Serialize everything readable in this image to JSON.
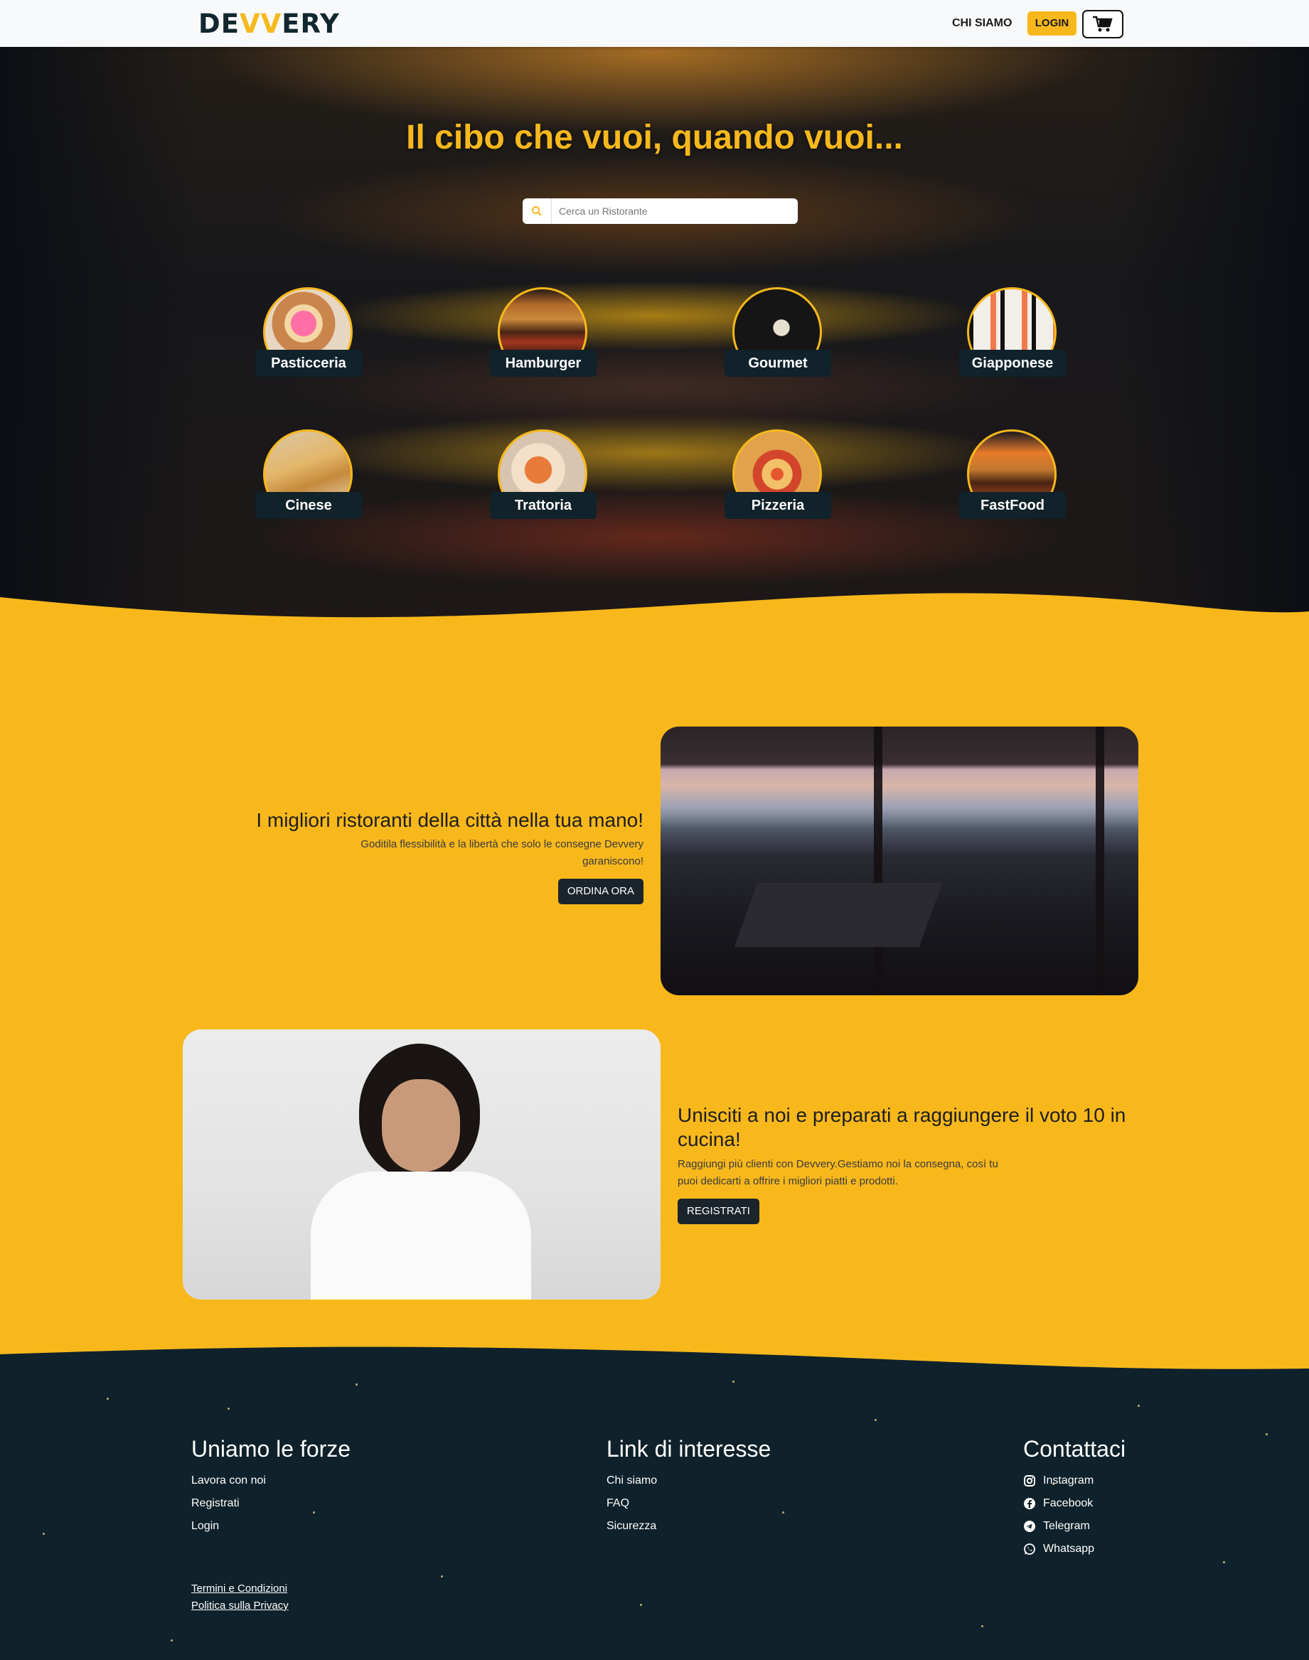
{
  "nav": {
    "logo_prefix": "DE",
    "logo_mid": "VV",
    "logo_suffix": "ERY",
    "link_about": "CHI SIAMO",
    "login": "LOGIN",
    "cart_icon": "cart-icon"
  },
  "hero": {
    "title": "Il cibo che vuoi, quando vuoi...",
    "search_placeholder": "Cerca un Ristorante",
    "categories": [
      {
        "label": "Pasticceria"
      },
      {
        "label": "Hamburger"
      },
      {
        "label": "Gourmet"
      },
      {
        "label": "Giapponese"
      },
      {
        "label": "Cinese"
      },
      {
        "label": "Trattoria"
      },
      {
        "label": "Pizzeria"
      },
      {
        "label": "FastFood"
      }
    ]
  },
  "sections": {
    "restaurants": {
      "title": "I migliori ristoranti della città nella tua mano!",
      "text": "Goditila flessibilità e la libertà che solo le consegne Devvery garaniscono!",
      "button": "ORDINA ORA"
    },
    "join": {
      "title": "Unisciti a noi e preparati a raggiungere il voto 10 in cucina!",
      "text": "Raggiungi più clienti con Devvery.Gestiamo noi la consegna, così tu puoi dedicarti a offrire i migliori piatti e prodotti.",
      "button": "REGISTRATI"
    }
  },
  "footer": {
    "col1": {
      "title": "Uniamo le forze",
      "links": [
        "Lavora con noi",
        "Registrati",
        "Login"
      ]
    },
    "col2": {
      "title": "Link di interesse",
      "links": [
        "Chi siamo",
        "FAQ",
        "Sicurezza"
      ]
    },
    "col3": {
      "title": "Contattaci",
      "links": [
        "Instagram",
        "Facebook",
        "Telegram",
        "Whatsapp"
      ]
    },
    "legal": [
      "Termini e Condizioni",
      "Politica sulla Privacy"
    ]
  },
  "colors": {
    "accent": "#f8b81c",
    "dark": "#0f222b"
  }
}
